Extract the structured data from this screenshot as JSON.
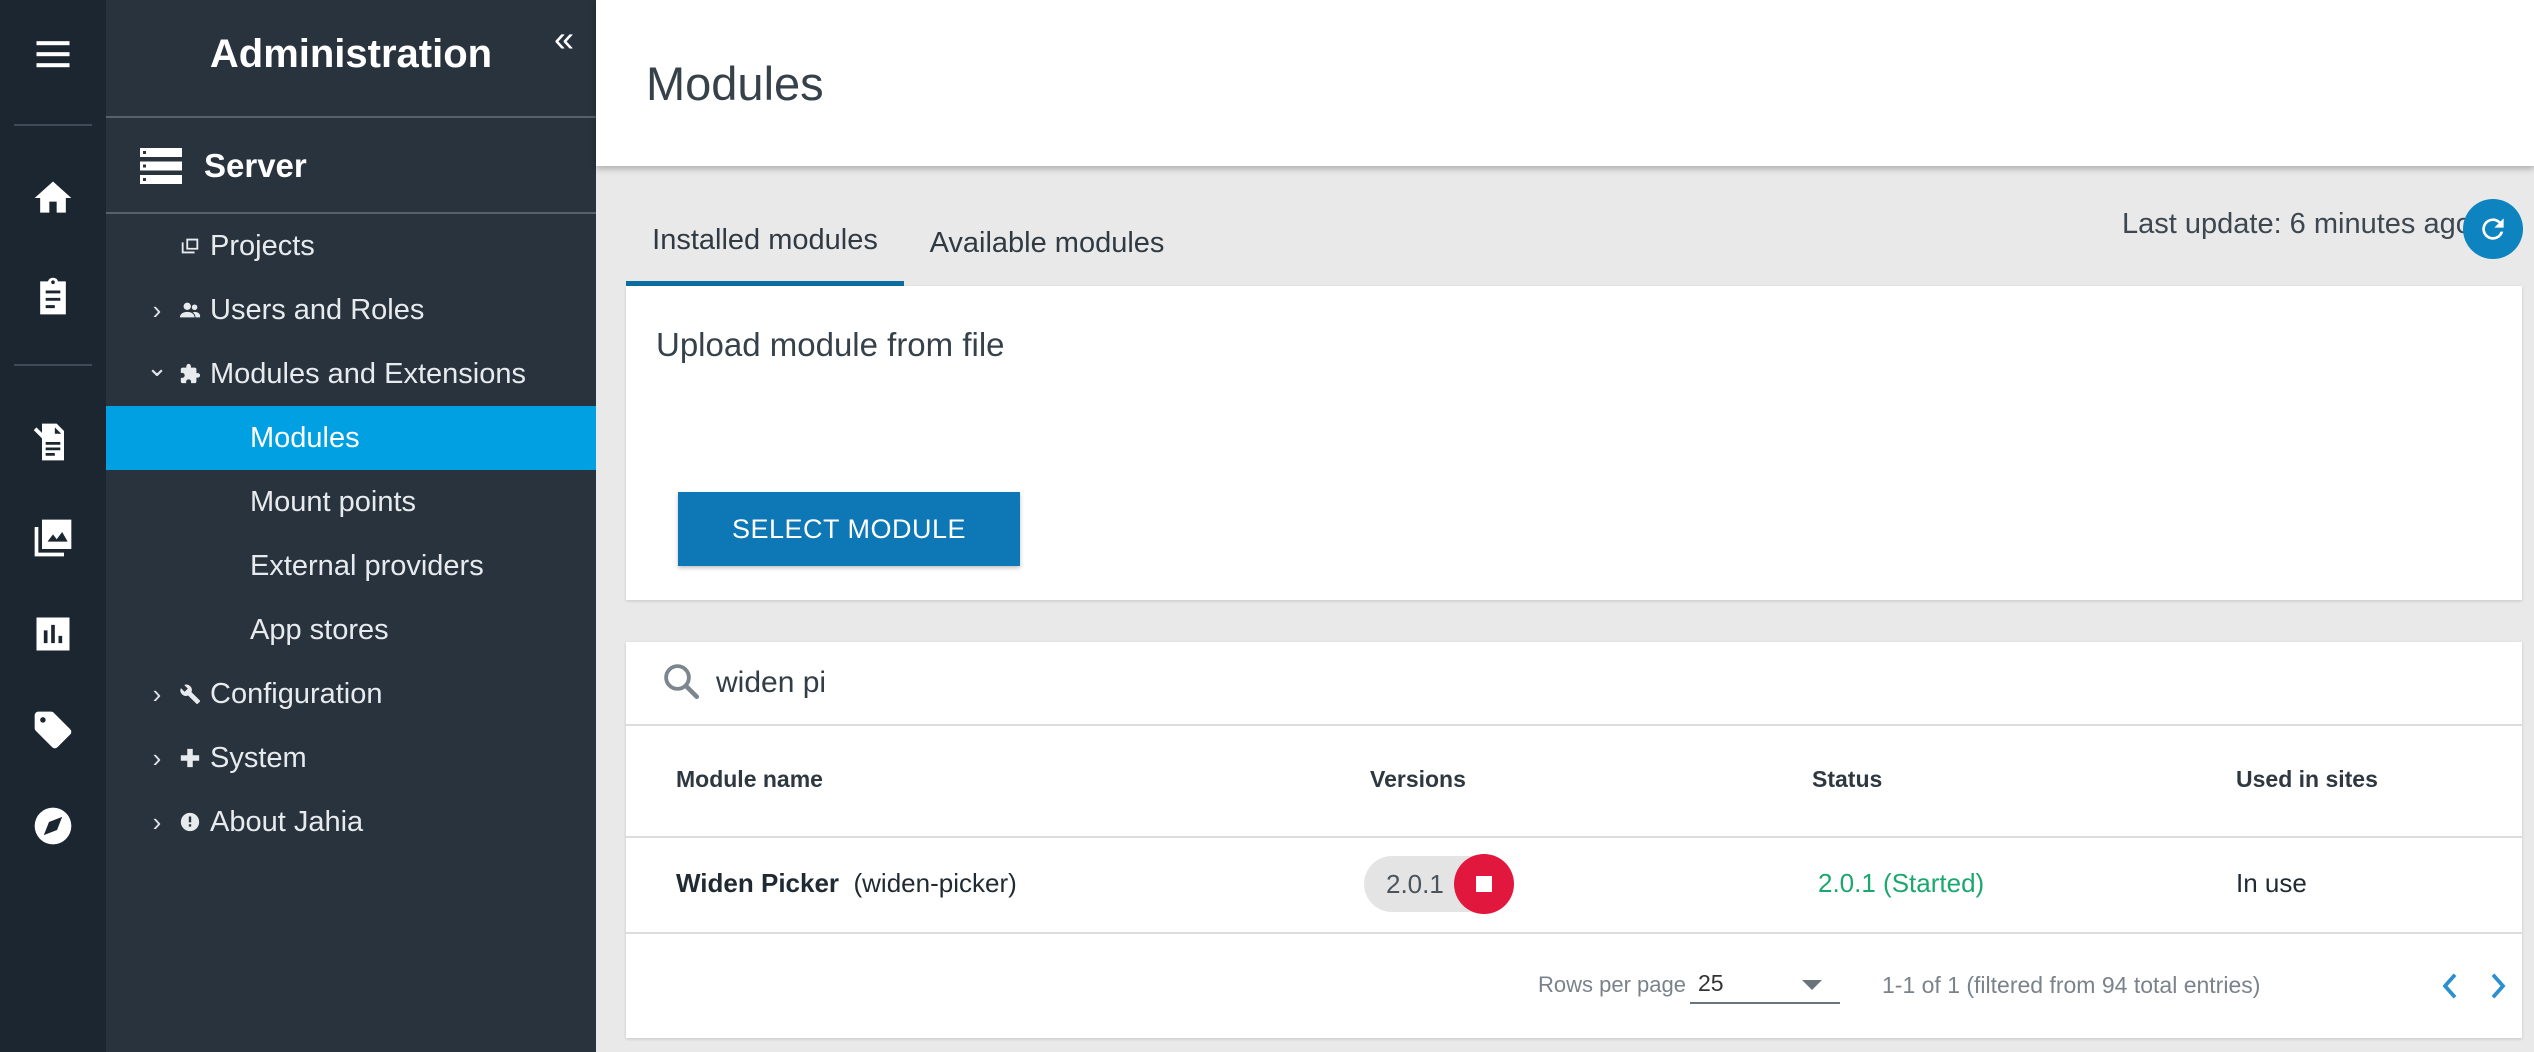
{
  "rail": {
    "icons": [
      "menu-icon",
      "home-icon",
      "clipboard-icon",
      "content-editor-icon",
      "media-icon",
      "chart-icon",
      "tag-icon",
      "compass-icon"
    ]
  },
  "sidebar": {
    "title": "Administration",
    "collapse_symbol": "«",
    "section": "Server",
    "items": [
      {
        "label": "Projects",
        "chevron": "",
        "icon": "projects-icon"
      },
      {
        "label": "Users and Roles",
        "chevron": "›",
        "icon": "users-icon"
      },
      {
        "label": "Modules and Extensions",
        "chevron": "⌄",
        "icon": "puzzle-icon"
      },
      {
        "label": "Modules"
      },
      {
        "label": "Mount points"
      },
      {
        "label": "External providers"
      },
      {
        "label": "App stores"
      },
      {
        "label": "Configuration",
        "chevron": "›",
        "icon": "wrench-icon"
      },
      {
        "label": "System",
        "chevron": "›",
        "icon": "plus-icon"
      },
      {
        "label": "About Jahia",
        "chevron": "›",
        "icon": "info-icon"
      }
    ],
    "active_item": "Modules"
  },
  "header": {
    "title": "Modules"
  },
  "tabs": [
    {
      "label": "Installed modules",
      "active": true
    },
    {
      "label": "Available modules",
      "active": false
    }
  ],
  "last_update": "Last update: 6 minutes ago",
  "upload": {
    "title": "Upload module from file",
    "button_label": "SELECT MODULE"
  },
  "search": {
    "value": "widen pi"
  },
  "table": {
    "columns": [
      "Module name",
      "Versions",
      "Status",
      "Used in sites"
    ],
    "rows": [
      {
        "name": "Widen Picker",
        "id": "(widen-picker)",
        "version": "2.0.1",
        "status": "2.0.1 (Started)",
        "used_in_sites": "In use"
      }
    ]
  },
  "pagination": {
    "rows_per_page_label": "Rows per page",
    "rows_per_page": "25",
    "range": "1-1 of 1 (filtered from 94 total entries)"
  },
  "colors": {
    "rail_bg": "#1c2630",
    "sidebar_bg": "#28333d",
    "active": "#00a0e3",
    "primary_button": "#0d78b5",
    "status_green": "#1ba86f",
    "stop_red": "#e2173d"
  }
}
